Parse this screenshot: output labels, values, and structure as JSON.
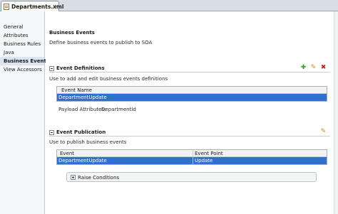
{
  "editor_tab": {
    "label": "Departments.xml",
    "close": "×"
  },
  "nav": {
    "items": [
      {
        "label": "General"
      },
      {
        "label": "Attributes"
      },
      {
        "label": "Business Rules"
      },
      {
        "label": "Java"
      },
      {
        "label": "Business Events",
        "selected": true
      },
      {
        "label": "View Accessors"
      }
    ]
  },
  "page": {
    "title": "Business Events",
    "description": "Define business events to publish to SOA"
  },
  "event_definitions": {
    "title": "Event Definitions",
    "description": "Use to add and edit business events definitions",
    "column_header": "Event Name",
    "rows": [
      {
        "name": "DepartmentUpdate"
      }
    ],
    "payload_label": "Payload Attributes:",
    "payload_value": "DepartmentId",
    "tools": {
      "add": "✚",
      "edit": "✎",
      "delete": "✖"
    }
  },
  "event_publication": {
    "title": "Event Publication",
    "description": "Use to publish business events",
    "columns": [
      "Event",
      "Event Point"
    ],
    "rows": [
      {
        "event": "DepartmentUpdate",
        "point": "Update"
      }
    ],
    "raise_conditions_label": "Raise Conditions",
    "tools": {
      "edit": "✎"
    }
  },
  "colors": {
    "selection": "#2f6fcd",
    "nav_selected": "#dbe5f2",
    "add_icon": "#3a9a2a",
    "edit_icon": "#c88a1a",
    "delete_icon": "#c61d1d"
  }
}
